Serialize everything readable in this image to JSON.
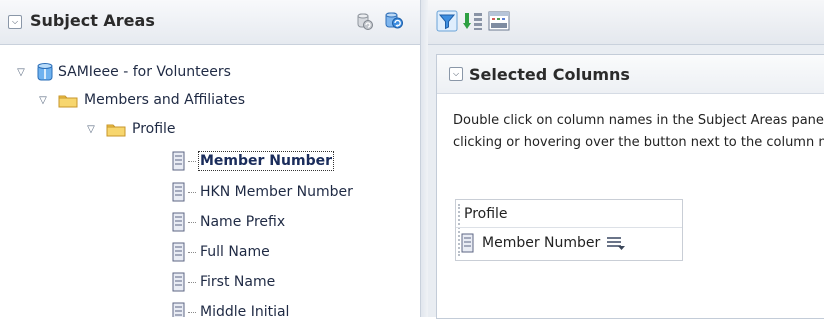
{
  "subject_areas": {
    "title": "Subject Areas",
    "tree": {
      "root": {
        "label": "SAMIeee - for Volunteers",
        "expanded": true
      },
      "folder1": {
        "label": "Members and Affiliates",
        "expanded": true
      },
      "folder2": {
        "label": "Profile",
        "expanded": true
      },
      "columns": [
        {
          "label": "Member Number",
          "selected": true
        },
        {
          "label": "HKN Member Number",
          "selected": false
        },
        {
          "label": "Name Prefix",
          "selected": false
        },
        {
          "label": "Full Name",
          "selected": false
        },
        {
          "label": "First Name",
          "selected": false
        },
        {
          "label": "Middle Initial",
          "selected": false
        }
      ]
    }
  },
  "selected_columns": {
    "title": "Selected Columns",
    "instruction_line1": "Double click on column names in the Subject Areas pane to add them to the selection. Drag and drop columns to reorder them. You can access column options by",
    "instruction_line2": "clicking or hovering over the button next to the column name.",
    "table_folder": "Profile",
    "columns": [
      {
        "label": "Member Number"
      }
    ]
  },
  "icons": {
    "header_left": [
      "database-refresh-icon",
      "refresh-icon"
    ],
    "toolbar": [
      "filter-icon",
      "sort-icon",
      "column-properties-icon"
    ]
  },
  "colors": {
    "folder": "#f3c64a",
    "folder_border": "#c7962a",
    "accent_blue": "#2f7fd0",
    "header_gradient_top": "#f8f9fb",
    "header_gradient_bottom": "#e6eaf0"
  }
}
